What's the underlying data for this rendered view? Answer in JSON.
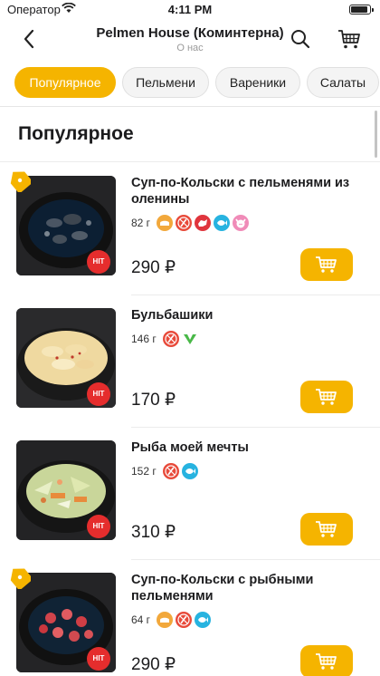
{
  "status_bar": {
    "carrier": "Оператор",
    "time": "4:11 PM"
  },
  "header": {
    "title": "Pelmen House (Коминтерна)",
    "subtitle": "О нас"
  },
  "categories": [
    {
      "label": "Популярное",
      "active": true
    },
    {
      "label": "Пельмени",
      "active": false
    },
    {
      "label": "Вареники",
      "active": false
    },
    {
      "label": "Салаты",
      "active": false
    }
  ],
  "section": {
    "title": "Популярное"
  },
  "products": [
    {
      "name": "Суп-по-Кольски с пельменями из оленины",
      "weight": "82 г",
      "price": "290 ₽",
      "hit": "HIT",
      "discount_tag": true,
      "photo": "soup-dark",
      "badges": [
        "bread-icon",
        "no-spicy-icon",
        "meat-icon",
        "fish-icon",
        "pig-icon"
      ]
    },
    {
      "name": "Бульбашики",
      "weight": "146 г",
      "price": "170 ₽",
      "hit": "HIT",
      "discount_tag": false,
      "photo": "dumplings",
      "badges": [
        "no-spicy-icon",
        "vegetarian-icon"
      ]
    },
    {
      "name": "Рыба моей мечты",
      "weight": "152 г",
      "price": "310 ₽",
      "hit": "HIT",
      "discount_tag": false,
      "photo": "salad",
      "badges": [
        "no-spicy-icon",
        "fish-icon"
      ]
    },
    {
      "name": "Суп-по-Кольски с рыбными пельменями",
      "weight": "64 г",
      "price": "290 ₽",
      "hit": "HIT",
      "discount_tag": true,
      "photo": "soup-red",
      "badges": [
        "bread-icon",
        "no-spicy-icon",
        "fish-icon"
      ]
    }
  ],
  "colors": {
    "accent": "#f5b400",
    "hit": "#e52d2d",
    "bread": "#f2a83b",
    "no_spicy": "#e84a3a",
    "meat": "#e0353d",
    "fish": "#27b3e0",
    "pig": "#f08bb8",
    "vegetarian": "#49b848"
  }
}
